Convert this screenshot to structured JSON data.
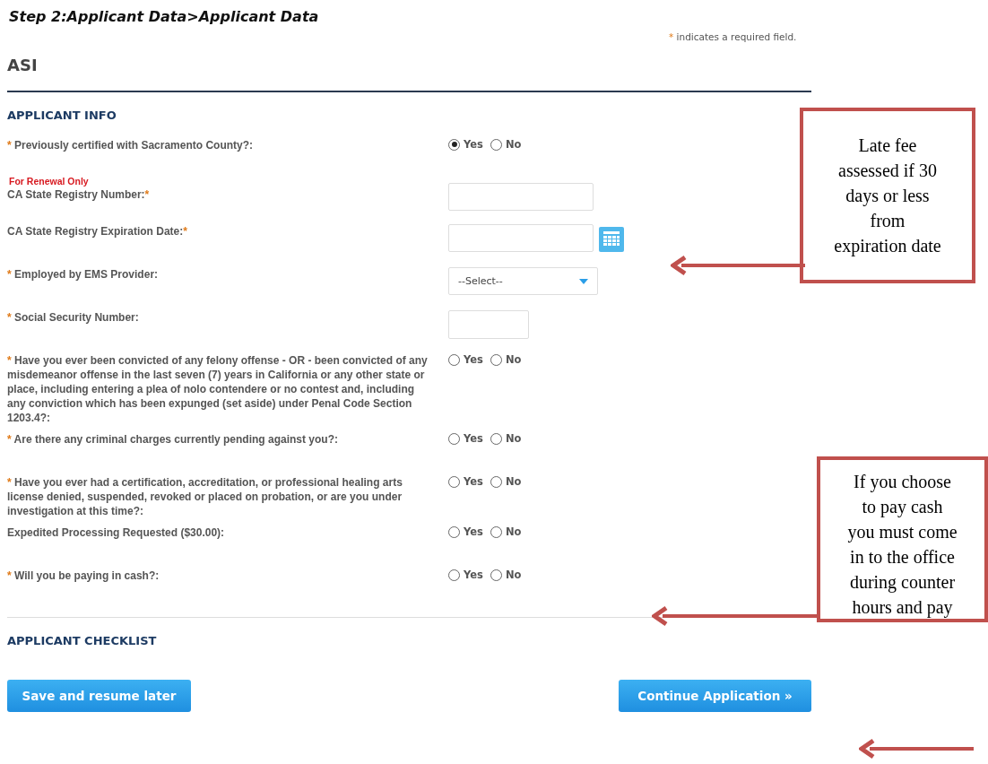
{
  "title": "Step 2:Applicant Data>Applicant Data",
  "required_note": {
    "mark": "*",
    "text": "indicates a required field."
  },
  "heading": "ASI",
  "sections": [
    {
      "title": "APPLICANT INFO",
      "fields": [
        {
          "kind": "radio",
          "mark_before": "*",
          "label": "Previously certified with Sacramento County?:",
          "options": [
            {
              "label": "Yes",
              "selected": true
            },
            {
              "label": "No",
              "selected": false
            }
          ]
        },
        {
          "kind": "text",
          "note": "For Renewal Only",
          "label": "CA State Registry Number:",
          "mark_after": "*"
        },
        {
          "kind": "date",
          "label": "CA State Registry Expiration Date:",
          "mark_after": "*"
        },
        {
          "kind": "select",
          "mark_before": "*",
          "label": "Employed by EMS Provider:",
          "value": "--Select--"
        },
        {
          "kind": "short_text",
          "mark_before": "*",
          "label": "Social Security Number:"
        },
        {
          "kind": "radio",
          "mark_before": "*",
          "label": "Have you ever been convicted of any felony offense - OR - been convicted of any misdemeanor offense in the last seven (7) years in California or any other state or place, including entering a plea of nolo contendere or no contest and, including any conviction which has been expunged (set aside) under Penal Code Section 1203.4?:",
          "options": [
            {
              "label": "Yes",
              "selected": false
            },
            {
              "label": "No",
              "selected": false
            }
          ]
        },
        {
          "kind": "radio",
          "mark_before": "*",
          "label": "Are there any criminal charges currently pending against you?:",
          "options": [
            {
              "label": "Yes",
              "selected": false
            },
            {
              "label": "No",
              "selected": false
            }
          ]
        },
        {
          "kind": "radio",
          "mark_before": "*",
          "label": "Have you ever had a certification, accreditation, or professional healing arts license denied, suspended, revoked or placed on probation, or are you under investigation at this time?:",
          "options": [
            {
              "label": "Yes",
              "selected": false
            },
            {
              "label": "No",
              "selected": false
            }
          ]
        },
        {
          "kind": "radio",
          "label": "Expedited Processing Requested ($30.00):",
          "options": [
            {
              "label": "Yes",
              "selected": false
            },
            {
              "label": "No",
              "selected": false
            }
          ]
        },
        {
          "kind": "radio",
          "mark_before": "*",
          "label": "Will you be paying in cash?:",
          "options": [
            {
              "label": "Yes",
              "selected": false
            },
            {
              "label": "No",
              "selected": false
            }
          ]
        }
      ]
    },
    {
      "title": "APPLICANT CHECKLIST"
    }
  ],
  "buttons": [
    {
      "label": "Save and resume later"
    },
    {
      "label": "Continue Application »"
    }
  ],
  "callouts": [
    {
      "lines": [
        "Late fee",
        "assessed if 30",
        "days or less",
        "from",
        "expiration date"
      ]
    },
    {
      "lines": [
        "If you choose",
        "to pay cash",
        "you must come",
        "in to the office",
        "during counter",
        "hours and pay"
      ]
    }
  ]
}
